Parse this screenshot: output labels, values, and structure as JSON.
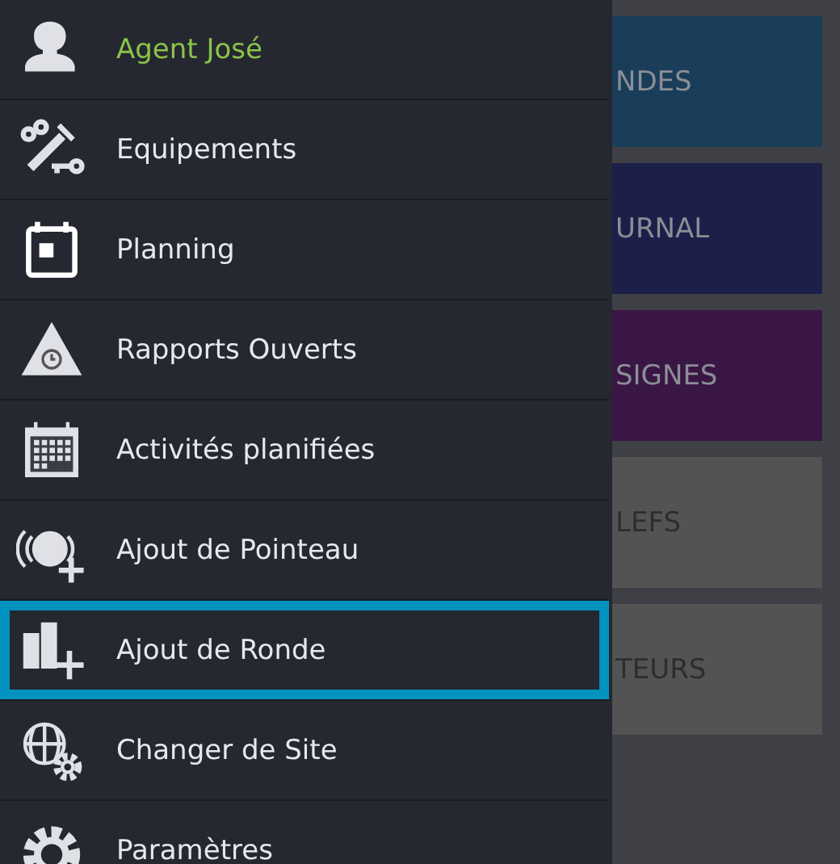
{
  "drawer": {
    "items": [
      {
        "kind": "user",
        "label": "Agent José",
        "selected": false
      },
      {
        "kind": "link",
        "label": "Equipements",
        "selected": false
      },
      {
        "kind": "link",
        "label": "Planning",
        "selected": false
      },
      {
        "kind": "link",
        "label": "Rapports Ouverts",
        "selected": false
      },
      {
        "kind": "link",
        "label": "Activités planifiées",
        "selected": false
      },
      {
        "kind": "link",
        "label": "Ajout de Pointeau",
        "selected": false
      },
      {
        "kind": "link",
        "label": "Ajout de Ronde",
        "selected": true
      },
      {
        "kind": "link",
        "label": "Changer de Site",
        "selected": false
      },
      {
        "kind": "link",
        "label": "Paramètres",
        "selected": false
      }
    ]
  },
  "tiles": [
    {
      "label": "NDES",
      "color": "#1a3d5a"
    },
    {
      "label": "URNAL",
      "color": "#1c1f48"
    },
    {
      "label": "SIGNES",
      "color": "#3a1645"
    },
    {
      "label": "LEFS",
      "color": "#535353"
    },
    {
      "label": "TEURS",
      "color": "#535353"
    }
  ]
}
